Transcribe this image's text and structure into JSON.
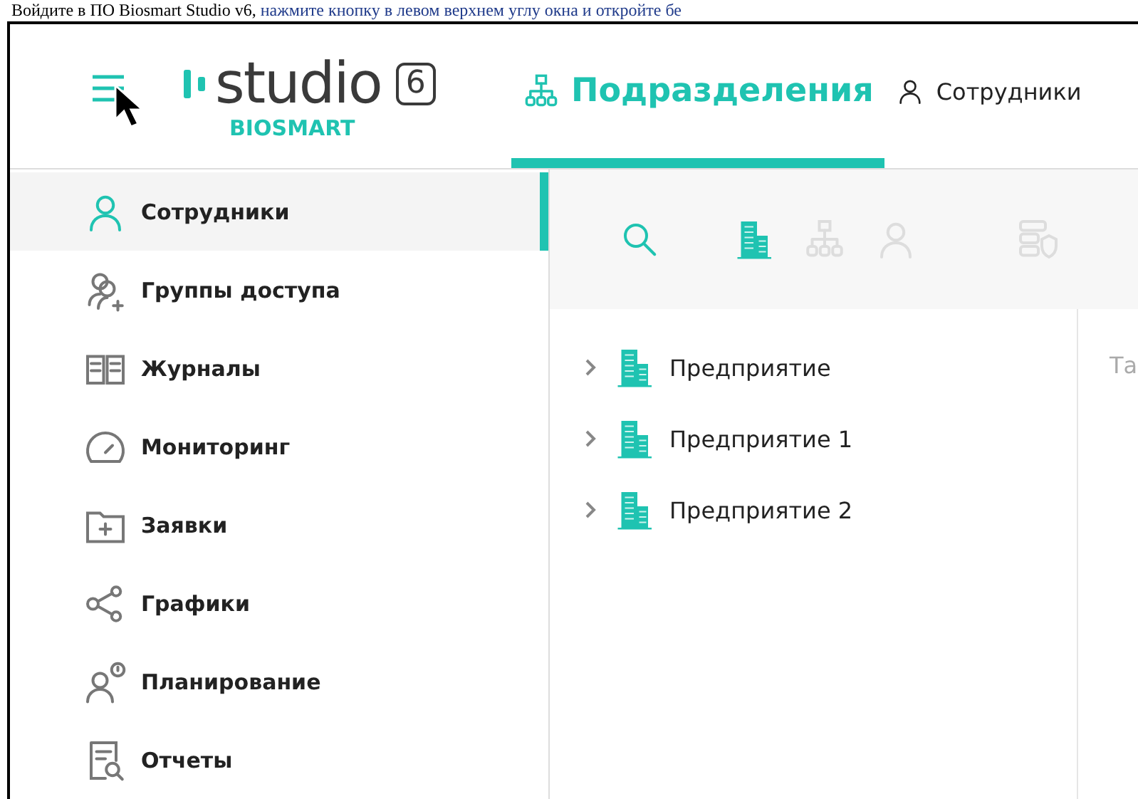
{
  "doc_text": {
    "plain": "Войдите в ПО Biosmart Studio v6, ",
    "link": "нажмите кнопку в левом верхнем углу окна и откройте бе"
  },
  "logo": {
    "word": "studio",
    "version": "6",
    "brand": "BIOSMART"
  },
  "tabs": [
    {
      "label": "Подразделения",
      "selected": true
    },
    {
      "label": "Сотрудники",
      "selected": false
    }
  ],
  "sidebar": {
    "items": [
      {
        "label": "Сотрудники",
        "selected": true
      },
      {
        "label": "Группы доступа",
        "selected": false
      },
      {
        "label": "Журналы",
        "selected": false
      },
      {
        "label": "Мониторинг",
        "selected": false
      },
      {
        "label": "Заявки",
        "selected": false
      },
      {
        "label": "Графики",
        "selected": false
      },
      {
        "label": "Планирование",
        "selected": false
      },
      {
        "label": "Отчеты",
        "selected": false
      }
    ]
  },
  "toolbar": [
    {
      "selected": true
    },
    {
      "selected": true
    },
    {
      "selected": false
    },
    {
      "selected": false
    },
    {
      "selected": false
    }
  ],
  "tree": [
    {
      "label": "Предприятие",
      "expanded": false
    },
    {
      "label": "Предприятие 1",
      "expanded": false
    },
    {
      "label": "Предприятие 2",
      "expanded": false
    }
  ],
  "right_panel": {
    "column_1": "Та"
  }
}
